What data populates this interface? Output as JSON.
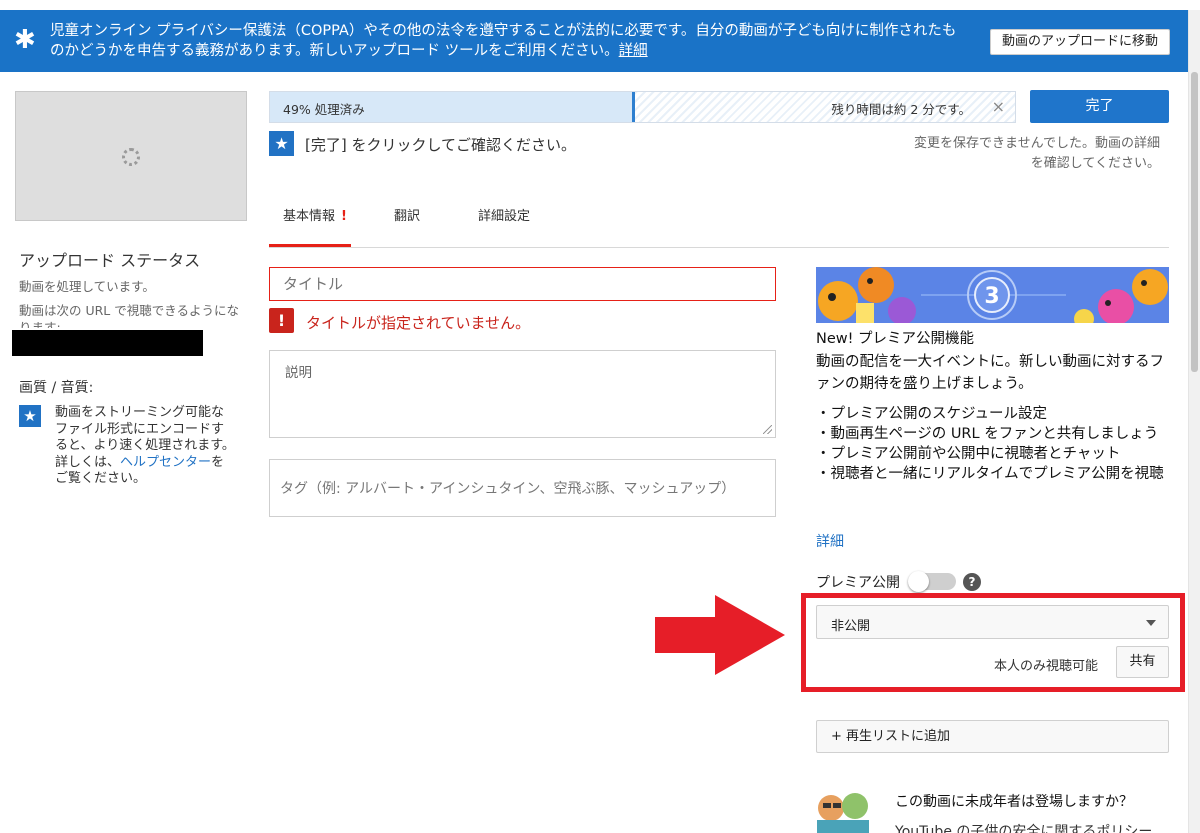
{
  "banner": {
    "message": "児童オンライン プライバシー保護法（COPPA）やその他の法令を遵守することが法的に必要です。自分の動画が子ども向けに制作されたものかどうかを申告する義務があります。新しいアップロード ツールをご利用ください。",
    "details_link": "詳細",
    "move_button": "動画のアップロードに移動"
  },
  "upload_status": {
    "title": "アップロード ステータス",
    "processing": "動画を処理しています。",
    "url_note": "動画は次の URL で視聴できるようになります:"
  },
  "quality": {
    "title": "画質 / 音質:",
    "text_before": "動画をストリーミング可能なファイル形式にエンコードすると、より速く処理されます。詳しくは、",
    "help_link": "ヘルプセンター",
    "text_after": "をご覧ください。"
  },
  "progress": {
    "percent": 49,
    "status": "49% 処理済み",
    "remaining": "残り時間は約 2 分です。",
    "cancel_icon": "×",
    "done_button": "完了"
  },
  "notice": {
    "click_done": "[完了] をクリックしてご確認ください。",
    "save_error": "変更を保存できませんでした。動画の詳細を確認してください。"
  },
  "tabs": {
    "basic": "基本情報",
    "basic_alert": "!",
    "translation": "翻訳",
    "advanced": "詳細設定"
  },
  "form": {
    "title_placeholder": "タイトル",
    "title_error": "タイトルが指定されていません。",
    "description_placeholder": "説明",
    "tags_placeholder": "タグ（例: アルバート・アインシュタイン、空飛ぶ豚、マッシュアップ）"
  },
  "premiere": {
    "art_number": "3",
    "title": "New! プレミア公開機能",
    "description": "動画の配信を一大イベントに。新しい動画に対するファンの期待を盛り上げましょう。",
    "features": [
      "・プレミア公開のスケジュール設定",
      "・動画再生ページの URL をファンと共有しましょう",
      "・プレミア公開前や公開中に視聴者とチャット",
      "・視聴者と一緒にリアルタイムでプレミア公開を視聴"
    ],
    "more_link": "詳細",
    "toggle_label": "プレミア公開",
    "toggle_on": false
  },
  "privacy": {
    "selected": "非公開",
    "note": "本人のみ視聴可能",
    "share_button": "共有"
  },
  "playlist": {
    "add_button": "+ 再生リストに追加"
  },
  "kids": {
    "question": "この動画に未成年者は登場しますか？",
    "subtext": "YouTube の子供の安全に関するポリシー"
  },
  "colors": {
    "banner_blue": "#1a73c7",
    "accent_blue": "#1f75cb",
    "error_red": "#c9241c",
    "highlight_red": "#e61e28"
  }
}
